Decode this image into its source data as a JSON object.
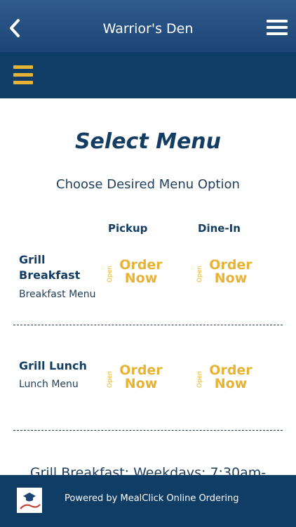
{
  "header": {
    "title": "Warrior's Den",
    "back_icon": "chevron-left-icon",
    "menu_icon": "hamburger-menu-icon"
  },
  "subheader": {
    "menu_icon": "hamburger-menu-icon"
  },
  "main": {
    "title": "Select Menu",
    "subtitle": "Choose Desired Menu Option",
    "columns": [
      "Pickup",
      "Dine-In"
    ],
    "rows": [
      {
        "name": "Grill Breakfast",
        "description": "Breakfast Menu",
        "pickup": {
          "status": "Open",
          "label": "Order Now"
        },
        "dinein": {
          "status": "Open",
          "label": "Order Now"
        }
      },
      {
        "name": "Grill Lunch",
        "description": "Lunch Menu",
        "pickup": {
          "status": "Open",
          "label": "Order Now"
        },
        "dinein": {
          "status": "Open",
          "label": "Order Now"
        }
      }
    ],
    "hours_text": "Grill Breakfast: Weekdays: 7:30am-"
  },
  "footer": {
    "powered_by": "Powered by MealClick Online Ordering",
    "logo_text": "Meal Click"
  },
  "colors": {
    "header_bg": "#234d7e",
    "subheader_bg": "#0f3d66",
    "accent_gold": "#e7b334",
    "text_navy": "#143d63"
  }
}
